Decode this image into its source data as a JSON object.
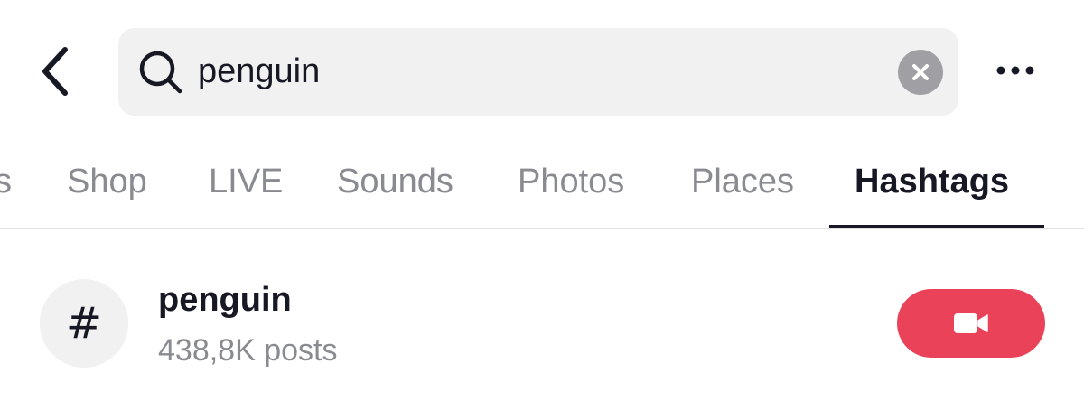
{
  "header": {
    "back_icon": "chevron-left-icon",
    "search": {
      "icon": "search-icon",
      "value": "penguin",
      "clear_icon": "clear-icon"
    },
    "more_icon": "more-horizontal-icon"
  },
  "tabs": [
    {
      "label": "s",
      "active": false
    },
    {
      "label": "Shop",
      "active": false
    },
    {
      "label": "LIVE",
      "active": false
    },
    {
      "label": "Sounds",
      "active": false
    },
    {
      "label": "Photos",
      "active": false
    },
    {
      "label": "Places",
      "active": false
    },
    {
      "label": "Hashtags",
      "active": true
    }
  ],
  "results": [
    {
      "symbol": "#",
      "name": "penguin",
      "count": "438,8K posts",
      "action_icon": "video-camera-icon"
    }
  ],
  "colors": {
    "accent": "#ea4359",
    "text_primary": "#161823",
    "text_secondary": "#8a8b91",
    "surface": "#f1f1f2"
  }
}
